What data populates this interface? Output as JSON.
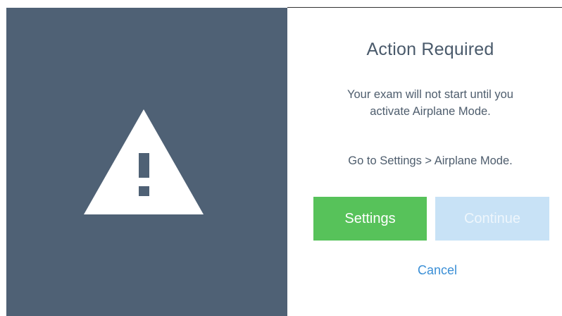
{
  "dialog": {
    "title": "Action Required",
    "message_line1": "Your exam will not start until you",
    "message_line2": "activate Airplane Mode.",
    "instruction": "Go to Settings > Airplane Mode.",
    "settings_label": "Settings",
    "continue_label": "Continue",
    "cancel_label": "Cancel",
    "continue_enabled": false
  },
  "icons": {
    "alert": "warning-triangle-icon"
  },
  "colors": {
    "panel_background": "#4f6175",
    "title_text": "#4a5a6b",
    "body_text": "#4e5d6d",
    "settings_button": "#57c25a",
    "continue_button_disabled": "#c8e2f6",
    "cancel_link": "#3b8fd6"
  }
}
